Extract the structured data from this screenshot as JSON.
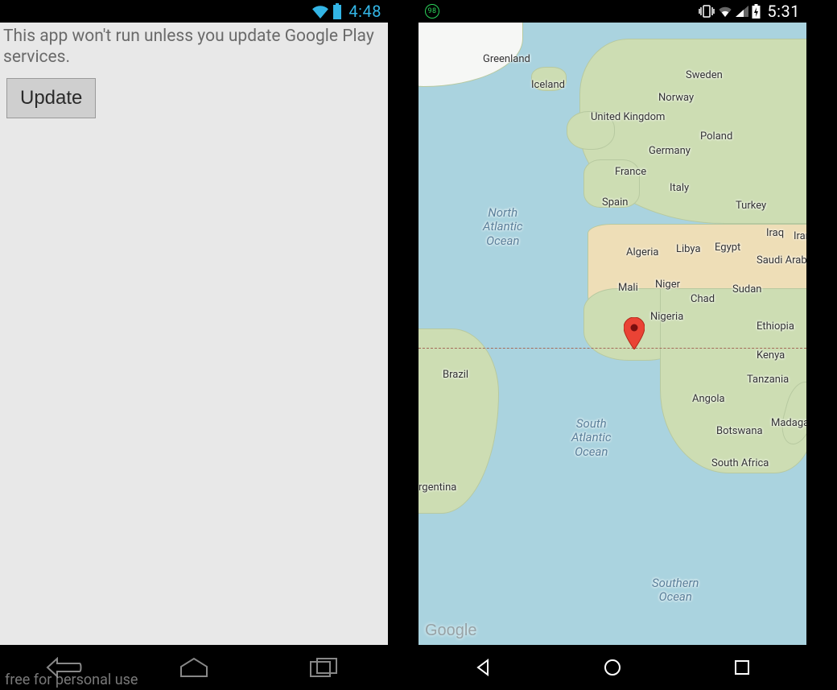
{
  "left_phone": {
    "status": {
      "time": "4:48"
    },
    "message": "This app won't run unless you update Google Play services.",
    "update_button_label": "Update",
    "watermark": "free for personal use"
  },
  "right_phone": {
    "status": {
      "badge": "98",
      "time": "5:31"
    },
    "map": {
      "oceans": {
        "north_atlantic": "North Atlantic Ocean",
        "south_atlantic": "South Atlantic Ocean",
        "southern": "Southern Ocean"
      },
      "labels": {
        "greenland": "Greenland",
        "iceland": "Iceland",
        "sweden": "Sweden",
        "norway": "Norway",
        "uk": "United Kingdom",
        "poland": "Poland",
        "germany": "Germany",
        "france": "France",
        "italy": "Italy",
        "spain": "Spain",
        "turkey": "Turkey",
        "iraq": "Iraq",
        "iran": "Iran",
        "saudi": "Saudi Arabia",
        "egypt": "Egypt",
        "libya": "Libya",
        "algeria": "Algeria",
        "mali": "Mali",
        "niger": "Niger",
        "chad": "Chad",
        "sudan": "Sudan",
        "nigeria": "Nigeria",
        "ethiopia": "Ethiopia",
        "kenya": "Kenya",
        "tanzania": "Tanzania",
        "angola": "Angola",
        "botswana": "Botswana",
        "madagascar": "Madagascar",
        "south_africa": "South Africa",
        "brazil": "Brazil",
        "argentina": "rgentina"
      },
      "attribution": "Google"
    }
  }
}
